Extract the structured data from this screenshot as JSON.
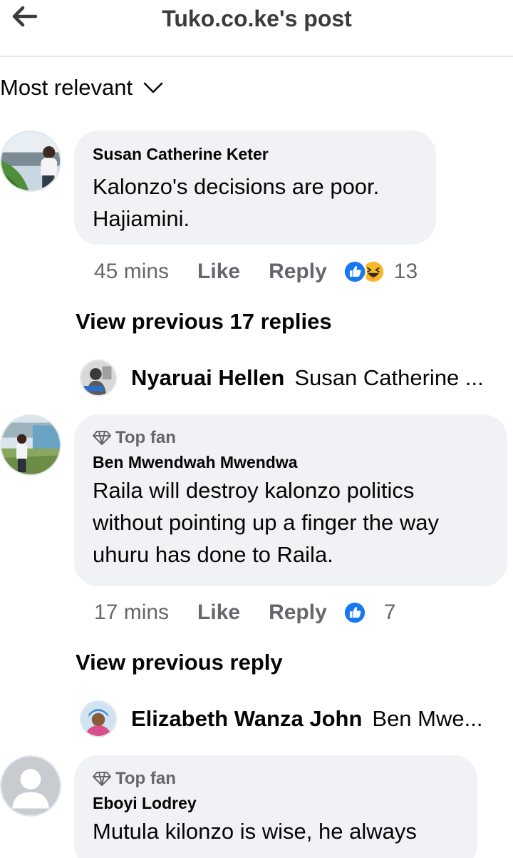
{
  "header": {
    "title": "Tuko.co.ke's post",
    "back_icon": "arrow-left-icon"
  },
  "sort": {
    "label": "Most relevant",
    "icon": "chevron-down-icon"
  },
  "comments": [
    {
      "author": "Susan Catherine Keter",
      "text_lines": [
        "Kalonzo's decisions are poor.",
        "Hajiamini."
      ],
      "time": "45 mins",
      "like_label": "Like",
      "reply_label": "Reply",
      "reactions": [
        "like",
        "haha"
      ],
      "reaction_count": "13",
      "view_previous": "View previous 17 replies",
      "reply_preview": {
        "name": "Nyaruai Hellen",
        "snippet": "Susan Catherine ..."
      }
    },
    {
      "badge": "Top fan",
      "author": "Ben Mwendwah Mwendwa",
      "text_lines": [
        "Raila will destroy kalonzo politics",
        "without pointing up a finger the way",
        "uhuru has done to Raila."
      ],
      "time": "17 mins",
      "like_label": "Like",
      "reply_label": "Reply",
      "reactions": [
        "like"
      ],
      "reaction_count": "7",
      "view_previous": "View previous reply",
      "reply_preview": {
        "name": "Elizabeth Wanza John",
        "snippet": "Ben Mwe..."
      }
    },
    {
      "badge": "Top fan",
      "author": "Eboyi Lodrey",
      "text_lines": [
        "Mutula kilonzo is wise, he always"
      ]
    }
  ],
  "colors": {
    "like_blue": "#1877f2",
    "haha_yellow": "#f7b928",
    "bubble_bg": "#f0f2f5",
    "muted": "#65676b"
  }
}
